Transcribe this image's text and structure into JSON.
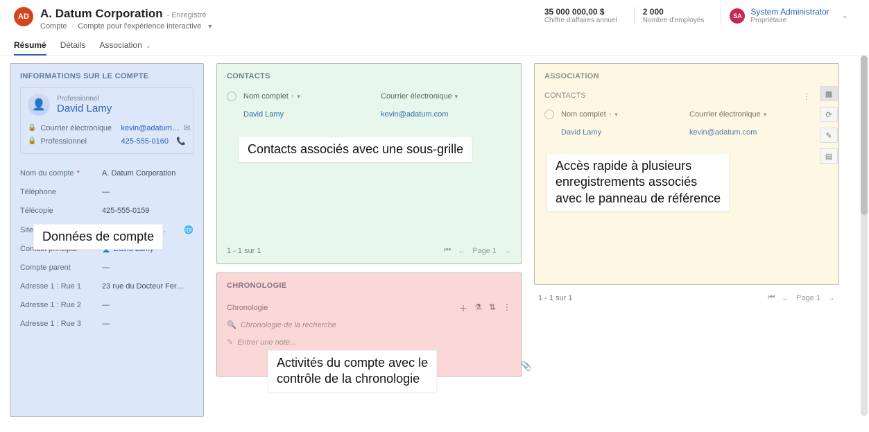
{
  "header": {
    "avatar_initials": "AD",
    "title": "A. Datum Corporation",
    "saved_state": "- Enregistré",
    "entity": "Compte",
    "form_name": "Compte pour l'expérience interactive",
    "metrics": [
      {
        "value": "35 000 000,00 $",
        "label": "Chiffre d'affaires annuel"
      },
      {
        "value": "2 000",
        "label": "Nombre d'employés"
      }
    ],
    "owner": {
      "initials": "SA",
      "name": "System Administrator",
      "role": "Propriétaire"
    }
  },
  "tabs": [
    "Résumé",
    "Détails",
    "Association"
  ],
  "account_info": {
    "section_title": "INFORMATIONS SUR LE COMPTE",
    "contact_card": {
      "role": "Professionnel",
      "name": "David Lamy",
      "email_label": "Courrier électronique",
      "email_value": "kevin@adatum…",
      "phone_label": "Professionnel",
      "phone_value": "425-555-0160"
    },
    "fields": [
      {
        "label": "Nom du compte",
        "required": true,
        "value": "A. Datum Corporation"
      },
      {
        "label": "Téléphone",
        "value": "—"
      },
      {
        "label": "Télécopie",
        "value": "425-555-0159"
      },
      {
        "label": "Site Web",
        "value": "http://www.adatu…",
        "more": true
      },
      {
        "label": "Contact principal",
        "value": "David Lamy",
        "link": true,
        "icon": true
      },
      {
        "label": "Compte parent",
        "value": "—"
      },
      {
        "label": "Adresse 1 : Rue 1",
        "value": "23 rue du Docteur Fer…"
      },
      {
        "label": "Adresse 1 : Rue 2",
        "value": "—"
      },
      {
        "label": "Adresse 1 : Rue 3",
        "value": "—"
      }
    ]
  },
  "contacts_grid": {
    "title": "CONTACTS",
    "col1": "Nom complet",
    "col2": "Courrier électronique",
    "row_name": "David Lamy",
    "row_email": "kevin@adatum.com",
    "pager_count": "1 - 1 sur 1",
    "pager_page": "Page 1"
  },
  "timeline": {
    "title": "CHRONOLOGIE",
    "subtitle": "Chronologie",
    "search_placeholder": "Chronologie de la recherche",
    "note_placeholder": "Entrer une note…"
  },
  "association": {
    "title": "ASSOCIATION",
    "sub": "CONTACTS",
    "col1": "Nom complet",
    "col2": "Courrier électronique",
    "row_name": "David Lamy",
    "row_email": "kevin@adatum.com",
    "pager_count": "1 - 1 sur 1",
    "pager_page": "Page 1"
  },
  "callouts": {
    "left": "Données de compte",
    "mid_top": "Contacts associés avec une sous-grille",
    "mid_bot": "Activités du compte avec le\ncontrôle de la chronologie",
    "right": "Accès rapide à plusieurs\nenregistrements associés\navec le panneau de référence"
  }
}
